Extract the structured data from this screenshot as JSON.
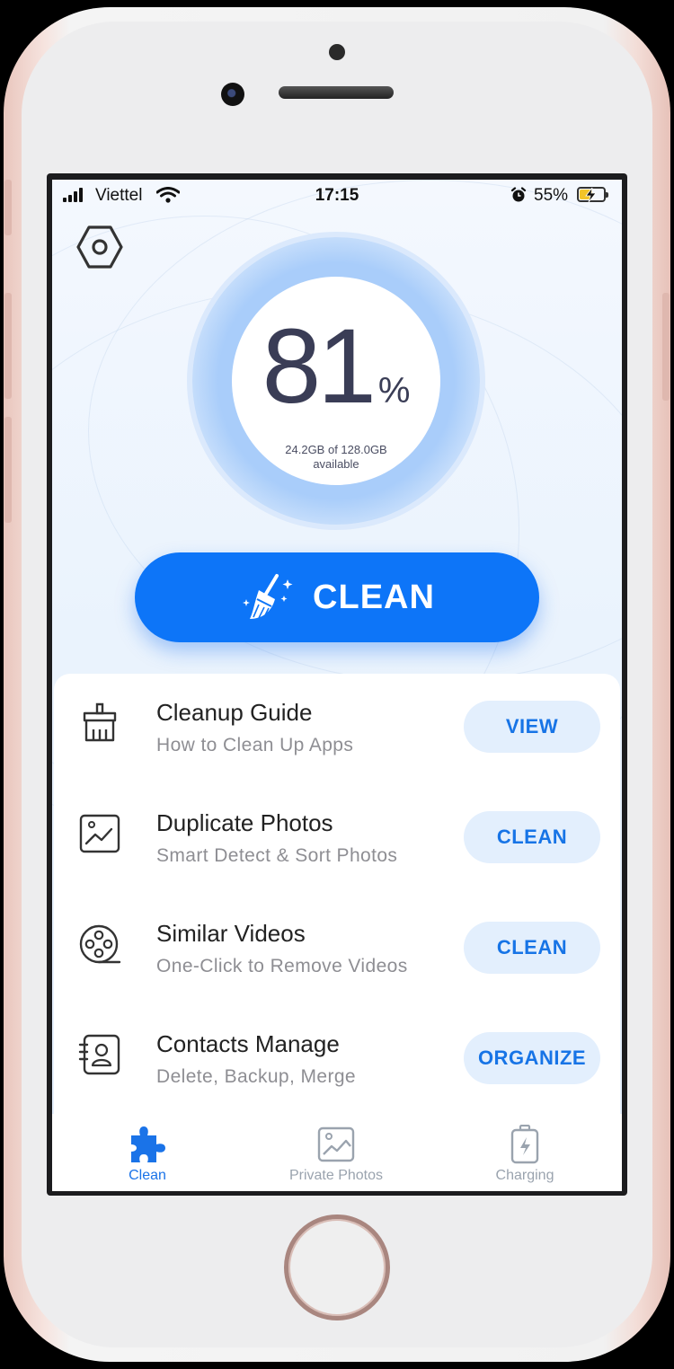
{
  "status_bar": {
    "carrier": "Viettel",
    "time": "17:15",
    "battery_percent": "55%",
    "battery_level": 0.55
  },
  "storage": {
    "percent": "81",
    "percent_symbol": "%",
    "available_line1": "24.2GB of 128.0GB",
    "available_line2": "available"
  },
  "main_button": {
    "label": "CLEAN",
    "icon": "broom-sparkle-icon"
  },
  "features": [
    {
      "title": "Cleanup Guide",
      "subtitle": "How to Clean Up Apps",
      "action": "VIEW",
      "icon": "broom-icon"
    },
    {
      "title": "Duplicate Photos",
      "subtitle": "Smart Detect & Sort Photos",
      "action": "CLEAN",
      "icon": "photo-icon"
    },
    {
      "title": "Similar Videos",
      "subtitle": "One-Click to Remove Videos",
      "action": "CLEAN",
      "icon": "film-reel-icon"
    },
    {
      "title": "Contacts Manage",
      "subtitle": "Delete, Backup, Merge",
      "action": "ORGANIZE",
      "icon": "contacts-icon"
    }
  ],
  "tabs": [
    {
      "label": "Clean",
      "icon": "puzzle-icon",
      "active": true
    },
    {
      "label": "Private Photos",
      "icon": "image-icon",
      "active": false
    },
    {
      "label": "Charging",
      "icon": "battery-charging-icon",
      "active": false
    }
  ],
  "colors": {
    "accent": "#0d75f8",
    "action_bg": "#e3effd",
    "action_text": "#1774e6",
    "tab_inactive": "#9aa3ae",
    "battery_fill": "#f2c428"
  }
}
